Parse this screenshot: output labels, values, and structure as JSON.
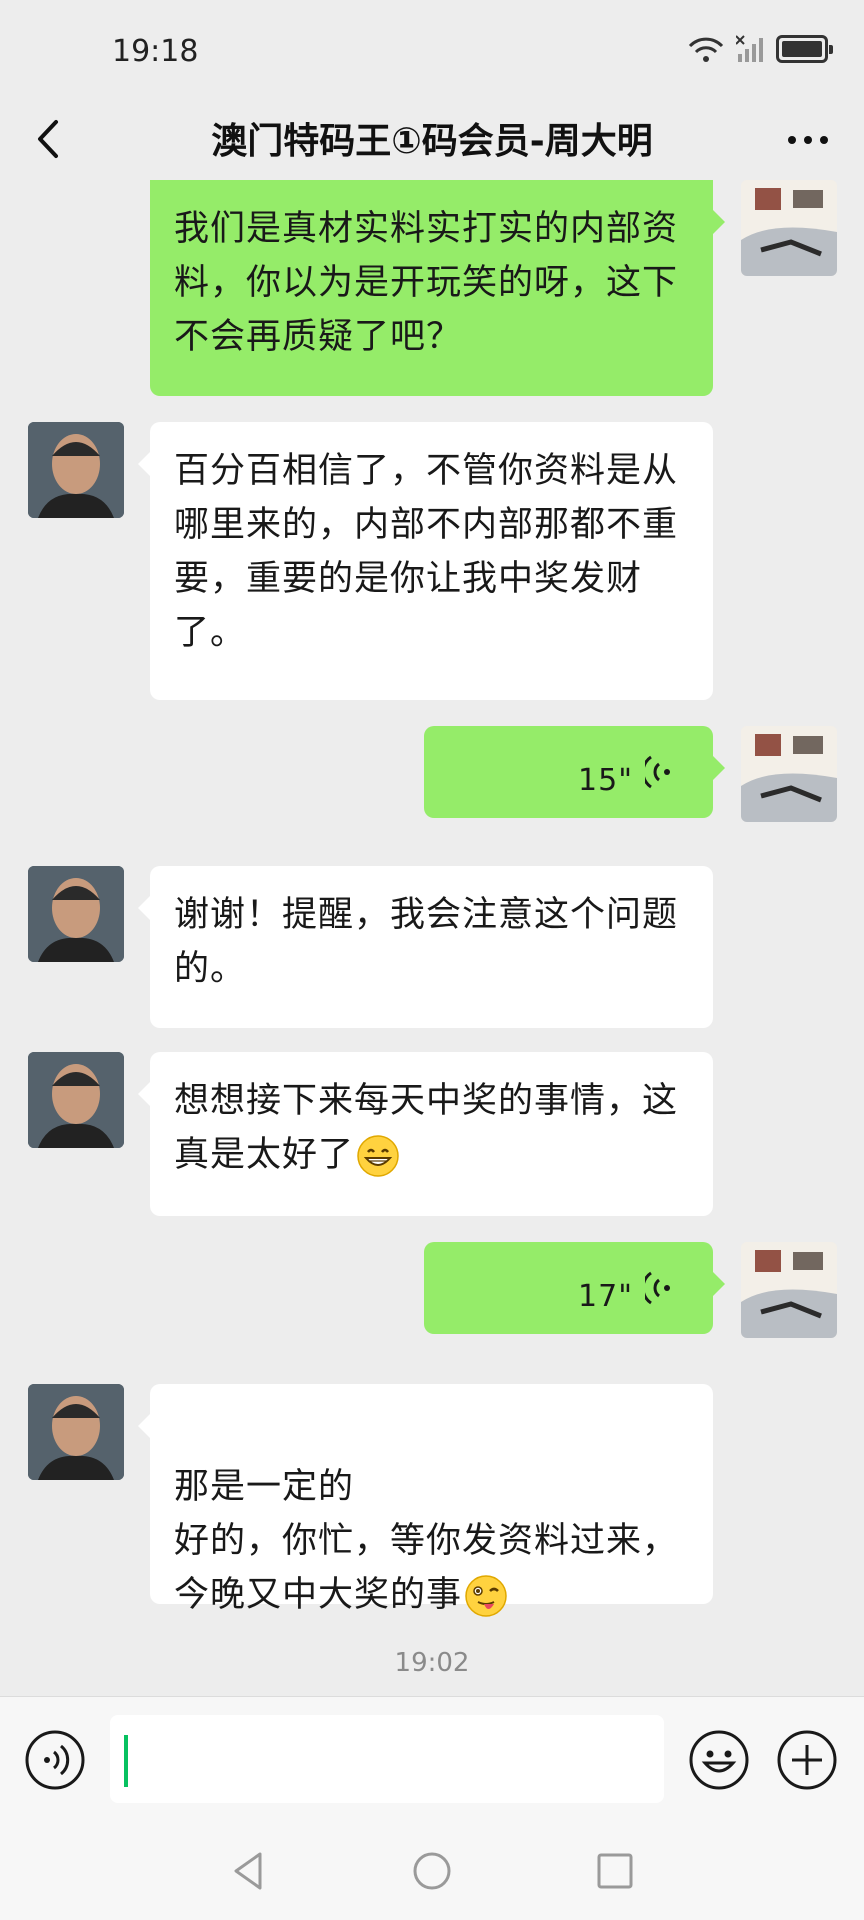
{
  "status_bar": {
    "time": "19:18"
  },
  "nav": {
    "title": "澳门特码王①码会员-周大明"
  },
  "messages": [
    {
      "side": "out",
      "type": "text",
      "text": "我们是真材实料实打实的内部资料，你以为是开玩笑的呀，这下不会再质疑了吧？"
    },
    {
      "side": "in",
      "type": "text",
      "text": "百分百相信了，不管你资料是从哪里来的，内部不内部那都不重要，重要的是你让我中奖发财了。"
    },
    {
      "side": "out",
      "type": "voice",
      "duration": "15\""
    },
    {
      "side": "in",
      "type": "text",
      "text": "谢谢！提醒，我会注意这个问题的。"
    },
    {
      "side": "in",
      "type": "text",
      "text": "想想接下来每天中奖的事情，这真是太好了",
      "emoji": "grin-emoji"
    },
    {
      "side": "out",
      "type": "voice",
      "duration": "17\""
    },
    {
      "side": "in",
      "type": "text",
      "text": "那是一定的\n好的，你忙，等你发资料过来，今晚又中大奖的事",
      "emoji": "wink-tongue-emoji"
    }
  ],
  "time_divider": "19:02",
  "input": {
    "value": ""
  },
  "icons": {
    "back": "back-chevron-icon",
    "more": "more-dots-icon",
    "voice_toggle": "voice-input-icon",
    "emoji": "smiley-icon",
    "plus": "plus-icon"
  },
  "colors": {
    "outgoing_bubble": "#95ec69",
    "incoming_bubble": "#ffffff",
    "background": "#ededed",
    "caret": "#07c160"
  }
}
